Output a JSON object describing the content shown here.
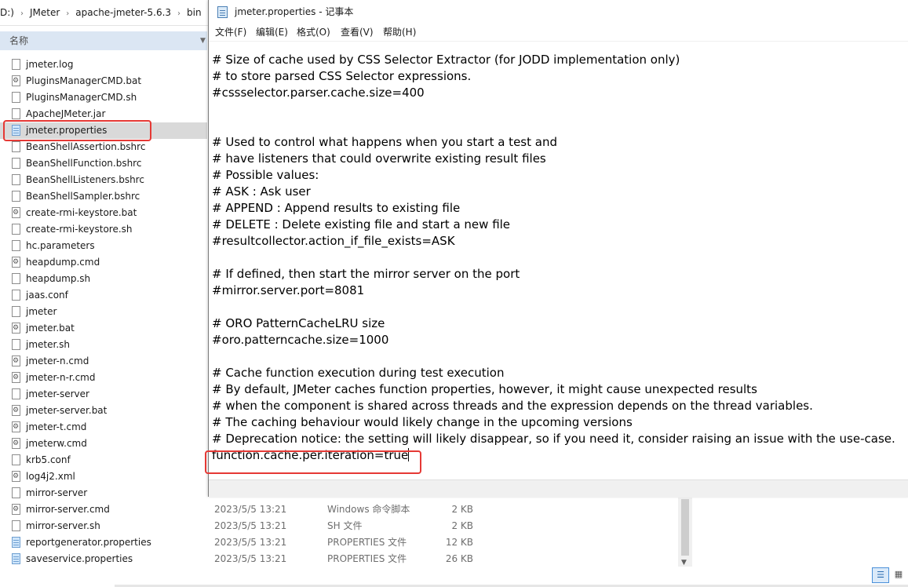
{
  "explorer": {
    "breadcrumb": [
      {
        "label": "D:)",
        "id": "drive"
      },
      {
        "label": "JMeter",
        "id": "jmeter"
      },
      {
        "label": "apache-jmeter-5.6.3",
        "id": "apache"
      },
      {
        "label": "bin",
        "id": "bin"
      }
    ],
    "column_name": "名称",
    "files": [
      {
        "name": "jmeter.log",
        "icon": "file"
      },
      {
        "name": "PluginsManagerCMD.bat",
        "icon": "gear-file"
      },
      {
        "name": "PluginsManagerCMD.sh",
        "icon": "file"
      },
      {
        "name": "ApacheJMeter.jar",
        "icon": "file"
      },
      {
        "name": "jmeter.properties",
        "icon": "properties",
        "selected": true
      },
      {
        "name": "BeanShellAssertion.bshrc",
        "icon": "file"
      },
      {
        "name": "BeanShellFunction.bshrc",
        "icon": "file"
      },
      {
        "name": "BeanShellListeners.bshrc",
        "icon": "file"
      },
      {
        "name": "BeanShellSampler.bshrc",
        "icon": "file"
      },
      {
        "name": "create-rmi-keystore.bat",
        "icon": "gear-file"
      },
      {
        "name": "create-rmi-keystore.sh",
        "icon": "file"
      },
      {
        "name": "hc.parameters",
        "icon": "file"
      },
      {
        "name": "heapdump.cmd",
        "icon": "gear-file"
      },
      {
        "name": "heapdump.sh",
        "icon": "file"
      },
      {
        "name": "jaas.conf",
        "icon": "file"
      },
      {
        "name": "jmeter",
        "icon": "file"
      },
      {
        "name": "jmeter.bat",
        "icon": "gear-file"
      },
      {
        "name": "jmeter.sh",
        "icon": "file"
      },
      {
        "name": "jmeter-n.cmd",
        "icon": "gear-file"
      },
      {
        "name": "jmeter-n-r.cmd",
        "icon": "gear-file"
      },
      {
        "name": "jmeter-server",
        "icon": "file"
      },
      {
        "name": "jmeter-server.bat",
        "icon": "gear-file"
      },
      {
        "name": "jmeter-t.cmd",
        "icon": "gear-file"
      },
      {
        "name": "jmeterw.cmd",
        "icon": "gear-file"
      },
      {
        "name": "krb5.conf",
        "icon": "file"
      },
      {
        "name": "log4j2.xml",
        "icon": "gear-file"
      },
      {
        "name": "mirror-server",
        "icon": "file"
      },
      {
        "name": "mirror-server.cmd",
        "icon": "gear-file",
        "date": "2023/5/5 13:21",
        "type": "Windows 命令脚本",
        "size": "2 KB"
      },
      {
        "name": "mirror-server.sh",
        "icon": "file",
        "date": "2023/5/5 13:21",
        "type": "SH 文件",
        "size": "2 KB"
      },
      {
        "name": "reportgenerator.properties",
        "icon": "properties",
        "date": "2023/5/5 13:21",
        "type": "PROPERTIES 文件",
        "size": "12 KB"
      },
      {
        "name": "saveservice.properties",
        "icon": "properties",
        "date": "2023/5/5 13:21",
        "type": "PROPERTIES 文件",
        "size": "26 KB"
      }
    ]
  },
  "notepad": {
    "title": "jmeter.properties - 记事本",
    "menus": [
      "文件(F)",
      "编辑(E)",
      "格式(O)",
      "查看(V)",
      "帮助(H)"
    ],
    "lines": [
      "# Size of cache used by CSS Selector Extractor (for JODD implementation only)",
      "# to store parsed CSS Selector expressions.",
      "#cssselector.parser.cache.size=400",
      "",
      "",
      "# Used to control what happens when you start a test and",
      "# have listeners that could overwrite existing result files",
      "# Possible values:",
      "# ASK : Ask user",
      "# APPEND : Append results to existing file",
      "# DELETE : Delete existing file and start a new file",
      "#resultcollector.action_if_file_exists=ASK",
      "",
      "# If defined, then start the mirror server on the port",
      "#mirror.server.port=8081",
      "",
      "# ORO PatternCacheLRU size",
      "#oro.patterncache.size=1000",
      "",
      "# Cache function execution during test execution",
      "# By default, JMeter caches function properties, however, it might cause unexpected results",
      "# when the component is shared across threads and the expression depends on the thread variables.",
      "# The caching behaviour would likely change in the upcoming versions",
      "# Deprecation notice: the setting will likely disappear, so if you need it, consider raising an issue with the use-case.",
      "function.cache.per.iteration=true"
    ]
  },
  "colors": {
    "highlight_box": "#e53935",
    "selected_row": "#d9d9d9",
    "column_header": "#dbe6f3"
  }
}
